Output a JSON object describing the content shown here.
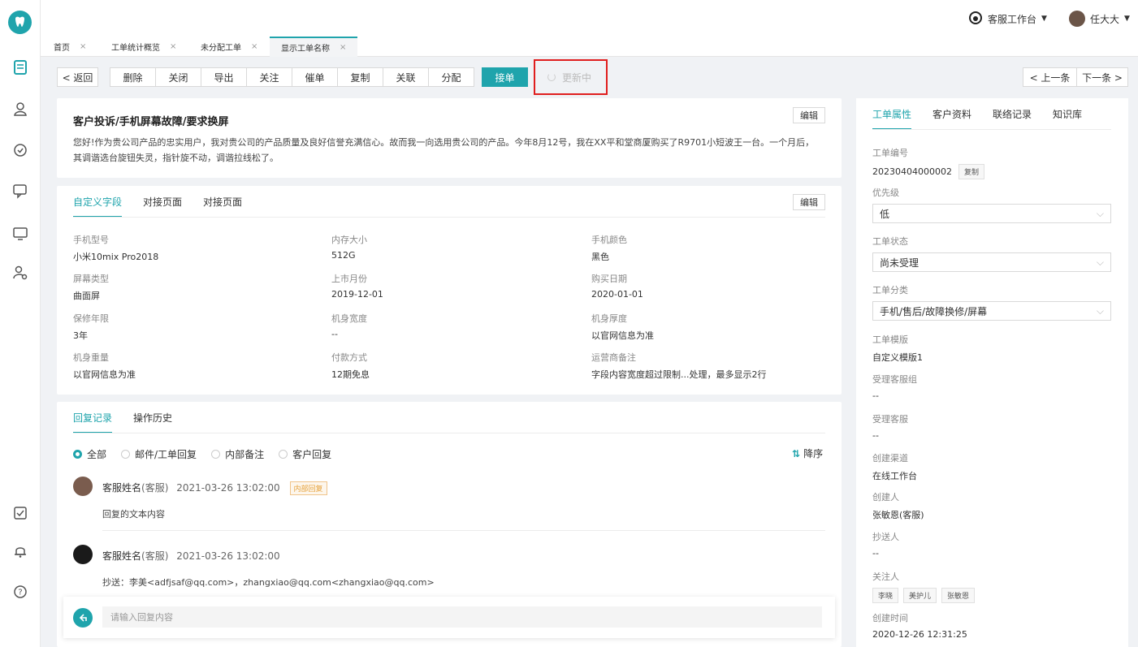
{
  "header": {
    "workspace_label": "客服工作台",
    "user_name": "任大大"
  },
  "tabs": [
    {
      "label": "首页"
    },
    {
      "label": "工单统计概览"
    },
    {
      "label": "未分配工单"
    },
    {
      "label": "显示工单名称"
    }
  ],
  "tab_close": "×",
  "toolbar": {
    "back": "< 返回",
    "actions": [
      "删除",
      "关闭",
      "导出",
      "关注",
      "催单",
      "复制",
      "关联",
      "分配"
    ],
    "accept": "接单",
    "updating": "更新中",
    "prev": "< 上一条",
    "next": "下一条 >"
  },
  "ticket": {
    "title": "客户投诉/手机屏幕故障/要求换屏",
    "edit": "编辑",
    "description": "您好!作为贵公司产品的忠实用户，我对贵公司的产品质量及良好信誉充满信心。故而我一向选用贵公司的产品。今年8月12号，我在XX平和堂商厦购买了R9701小短波王一台。一个月后，其调谐选台旋钮失灵，指针旋不动，调谐拉线松了。"
  },
  "fields_card": {
    "tabs": [
      "自定义字段",
      "对接页面",
      "对接页面"
    ],
    "edit": "编辑",
    "fields": [
      {
        "label": "手机型号",
        "value": "小米10mix Pro2018"
      },
      {
        "label": "内存大小",
        "value": "512G"
      },
      {
        "label": "手机颜色",
        "value": "黑色"
      },
      {
        "label": "屏幕类型",
        "value": "曲面屏"
      },
      {
        "label": "上市月份",
        "value": "2019-12-01"
      },
      {
        "label": "购买日期",
        "value": "2020-01-01"
      },
      {
        "label": "保修年限",
        "value": "3年"
      },
      {
        "label": "机身宽度",
        "value": "--"
      },
      {
        "label": "机身厚度",
        "value": "以官网信息为准"
      },
      {
        "label": "机身重量",
        "value": "以官网信息为准"
      },
      {
        "label": "付款方式",
        "value": "12期免息"
      },
      {
        "label": "运营商备注",
        "value": "字段内容宽度超过限制...处理，最多显示2行"
      }
    ]
  },
  "replies": {
    "tabs": [
      "回复记录",
      "操作历史"
    ],
    "filters": [
      "全部",
      "邮件/工单回复",
      "内部备注",
      "客户回复"
    ],
    "sort_label": "降序",
    "items": [
      {
        "name": "客服姓名",
        "role": "(客服)",
        "time": "2021-03-26 13:02:00",
        "badge": "内部回复",
        "content": "回复的文本内容"
      },
      {
        "name": "客服姓名",
        "role": "(客服)",
        "time": "2021-03-26 13:02:00",
        "badge": "",
        "content": "抄送：李美<adfjsaf@qq.com>，zhangxiao@qq.com<zhangxiao@qq.com>"
      }
    ],
    "input_placeholder": "请输入回复内容"
  },
  "sidebar": {
    "tabs": [
      "工单属性",
      "客户资料",
      "联络记录",
      "知识库"
    ],
    "ticket_no_label": "工单编号",
    "ticket_no": "20230404000002",
    "copy": "复制",
    "priority_label": "优先级",
    "priority": "低",
    "status_label": "工单状态",
    "status": "尚未受理",
    "category_label": "工单分类",
    "category": "手机/售后/故障换修/屏幕",
    "template_label": "工单模版",
    "template": "自定义模版1",
    "group_label": "受理客服组",
    "group": "--",
    "agent_label": "受理客服",
    "agent": "--",
    "channel_label": "创建渠道",
    "channel": "在线工作台",
    "creator_label": "创建人",
    "creator": "张敏恩(客服)",
    "cc_label": "抄送人",
    "cc": "--",
    "followers_label": "关注人",
    "followers": [
      "李晓",
      "美护儿",
      "张敏恩"
    ],
    "created_label": "创建时间",
    "created": "2020-12-26 12:31:25"
  },
  "colors": {
    "accent": "#1fa4ac",
    "highlight": "#e01e1e"
  }
}
